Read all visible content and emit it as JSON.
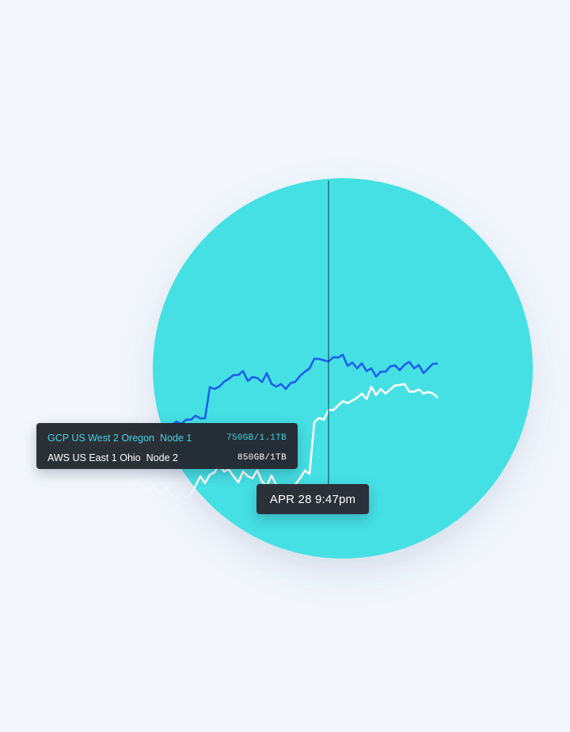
{
  "chart_data": {
    "type": "line",
    "x": [
      0,
      1,
      2,
      3,
      4,
      5,
      6,
      7,
      8,
      9,
      10,
      11,
      12,
      13,
      14,
      15,
      16,
      17,
      18,
      19,
      20,
      21,
      22,
      23,
      24,
      25,
      26,
      27,
      28,
      29,
      30,
      31,
      32,
      33,
      34,
      35,
      36,
      37,
      38,
      39,
      40,
      41,
      42,
      43,
      44,
      45,
      46,
      47,
      48,
      49,
      50,
      51,
      52,
      53,
      54,
      55,
      56,
      57,
      58,
      59,
      60,
      61,
      62,
      63,
      64,
      65,
      66,
      67,
      68,
      69,
      70,
      71,
      72,
      73,
      74,
      75,
      76,
      77,
      78,
      79,
      80,
      81,
      82,
      83,
      84
    ],
    "series": [
      {
        "name": "GCP US West 2 Oregon Node 1",
        "color": "#1e5ef0",
        "values": [
          45.5,
          47.1,
          46.8,
          49.8,
          53.0,
          50.0,
          52.3,
          46.2,
          51.3,
          52.3,
          55.5,
          53.0,
          57.7,
          57.7,
          62.0,
          59.2,
          59.2,
          93.5,
          91.4,
          94.0,
          99.4,
          102.5,
          106.8,
          106.8,
          111.2,
          100.2,
          104.6,
          103.6,
          99.1,
          108.9,
          97.0,
          94.0,
          97.0,
          91.4,
          97.9,
          99.4,
          105.8,
          110.5,
          114.1,
          124.8,
          124.6,
          123.0,
          121.6,
          126.5,
          126.0,
          129.1,
          116.8,
          120.7,
          114.1,
          119.8,
          111.2,
          114.1,
          105.1,
          110.5,
          110.5,
          116.3,
          117.4,
          112.1,
          118.2,
          121.3,
          114.1,
          117.8,
          108.9,
          114.1,
          119.3,
          119.3
        ]
      },
      {
        "name": "AWS US East 1 Ohio Node 2",
        "color": "#ffffff",
        "values": [
          -14.7,
          -12.1,
          -12.6,
          -18.1,
          -19.1,
          -14.6,
          -20.4,
          -23.4,
          -17.1,
          -26.3,
          -30.0,
          -22.5,
          -27.8,
          -24.0,
          -14.9,
          -4.5,
          -12.3,
          -2.9,
          -0.3,
          8.2,
          0.7,
          3.0,
          -4.5,
          -11.3,
          0.7,
          -4.5,
          -6.8,
          2.1,
          -10.4,
          -15.0,
          -3.7,
          -14.2,
          -26.3,
          -18.8,
          -18.8,
          -13.7,
          -6.8,
          1.7,
          -1.7,
          55.0,
          59.5,
          57.7,
          68.2,
          68.2,
          73.2,
          78.0,
          76.0,
          78.7,
          81.9,
          86.4,
          80.5,
          94.0,
          84.8,
          91.4,
          86.4,
          91.0,
          95.3,
          95.8,
          97.0,
          88.5,
          88.5,
          91.0,
          86.4,
          88.3,
          86.4,
          81.9
        ]
      }
    ],
    "tooltip": {
      "rows": [
        {
          "name": "GCP US West 2 Oregon",
          "node": "Node 1",
          "value": "750GB/1.1TB",
          "color": "#42d3e2"
        },
        {
          "name": "AWS US East 1 Ohio",
          "node": "Node 2",
          "value": "850GB/1TB",
          "color": "#ffffff"
        }
      ]
    },
    "cursor": {
      "x": 42,
      "label": "APR 28 9:47pm"
    },
    "xlim": [
      0,
      84
    ],
    "ylim": [
      -60,
      170
    ],
    "grid": false,
    "legend": "none"
  },
  "colors": {
    "background": "#f3f7fd",
    "circle": "#44e0e4",
    "cursor": "#0e3a48"
  }
}
